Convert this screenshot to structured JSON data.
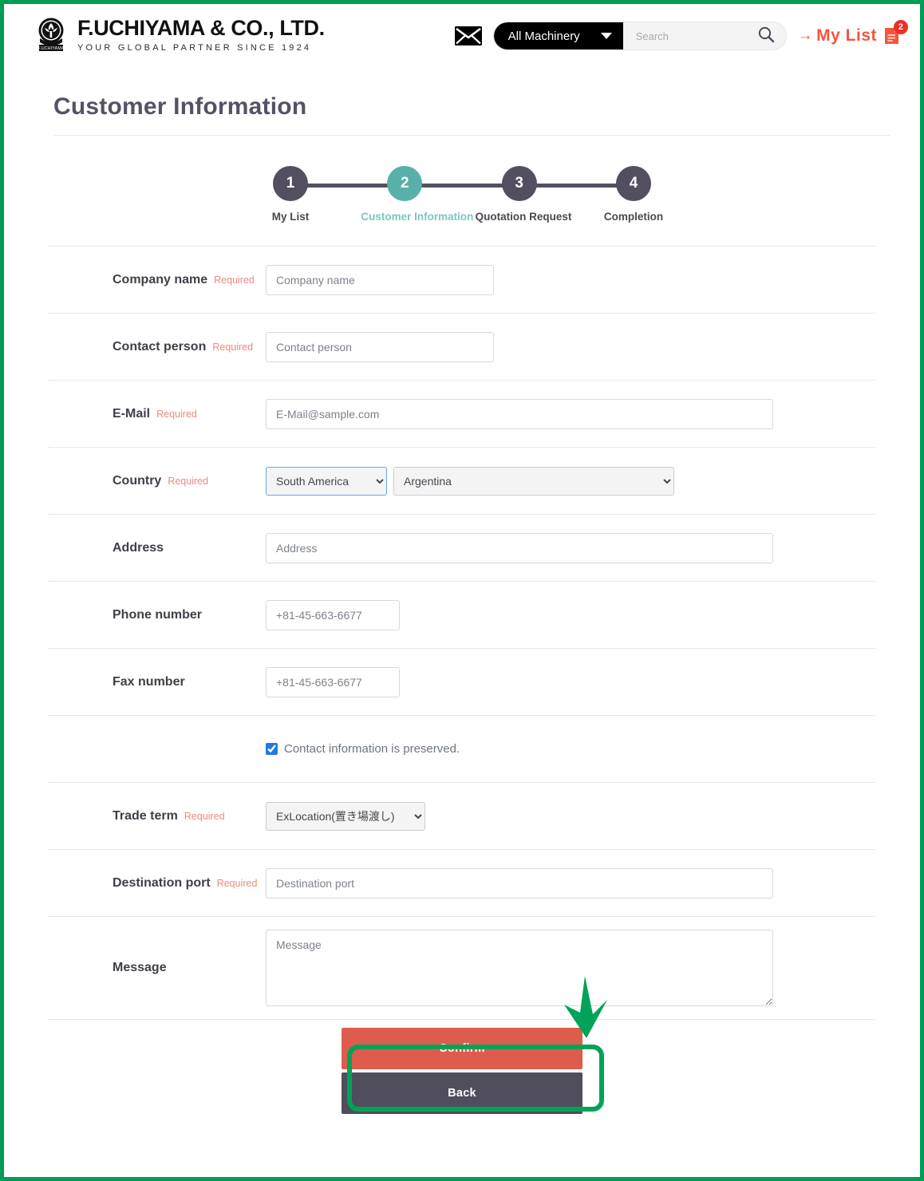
{
  "header": {
    "brand_name": "F.UCHIYAMA & CO., LTD.",
    "brand_tagline": "YOUR GLOBAL PARTNER SINCE 1924",
    "mail_icon": "envelope-icon",
    "category_label": "All Machinery",
    "search_placeholder": "Search",
    "search_value": "",
    "search_icon": "search-icon",
    "mylist_arrow": "→",
    "mylist_label": "My List",
    "mylist_doc_icon": "document-icon",
    "mylist_badge": "2"
  },
  "page": {
    "title": "Customer Information"
  },
  "stepper": {
    "steps": [
      {
        "number": "1",
        "label": "My List",
        "active": false
      },
      {
        "number": "2",
        "label": "Customer Information",
        "active": true
      },
      {
        "number": "3",
        "label": "Quotation Request",
        "active": false
      },
      {
        "number": "4",
        "label": "Completion",
        "active": false
      }
    ]
  },
  "form": {
    "required_text": "Required",
    "company": {
      "label": "Company name",
      "required": "Required",
      "placeholder": "Company name",
      "value": ""
    },
    "contact": {
      "label": "Contact person",
      "required": "Required",
      "placeholder": "Contact person",
      "value": ""
    },
    "email": {
      "label": "E-Mail",
      "required": "Required",
      "placeholder": "E-Mail@sample.com",
      "value": ""
    },
    "country": {
      "label": "Country",
      "required": "Required",
      "region_selected": "South America",
      "region_options": [
        "South America"
      ],
      "country_selected": "Argentina",
      "country_options": [
        "Argentina"
      ]
    },
    "address": {
      "label": "Address",
      "placeholder": "Address",
      "value": ""
    },
    "phone": {
      "label": "Phone number",
      "placeholder": "+81-45-663-6677",
      "value": ""
    },
    "fax": {
      "label": "Fax number",
      "placeholder": "+81-45-663-6677",
      "value": ""
    },
    "preserve": {
      "label": "Contact information is preserved.",
      "checked": true
    },
    "trade_term": {
      "label": "Trade term",
      "required": "Required",
      "selected": "ExLocation(置き場渡し)",
      "options": [
        "ExLocation(置き場渡し)"
      ]
    },
    "destination": {
      "label": "Destination port",
      "required": "Required",
      "placeholder": "Destination port",
      "value": ""
    },
    "message": {
      "label": "Message",
      "placeholder": "Message",
      "value": ""
    }
  },
  "actions": {
    "confirm_label": "Confirm",
    "back_label": "Back"
  },
  "colors": {
    "accent_teal": "#58b0aa",
    "step_dark": "#534f5f",
    "confirm_red": "#dd5c4e",
    "back_gray": "#504d5c",
    "required_red": "#ee8a7d",
    "mylist_red": "#f4553d",
    "annotation_green": "#00a357"
  }
}
